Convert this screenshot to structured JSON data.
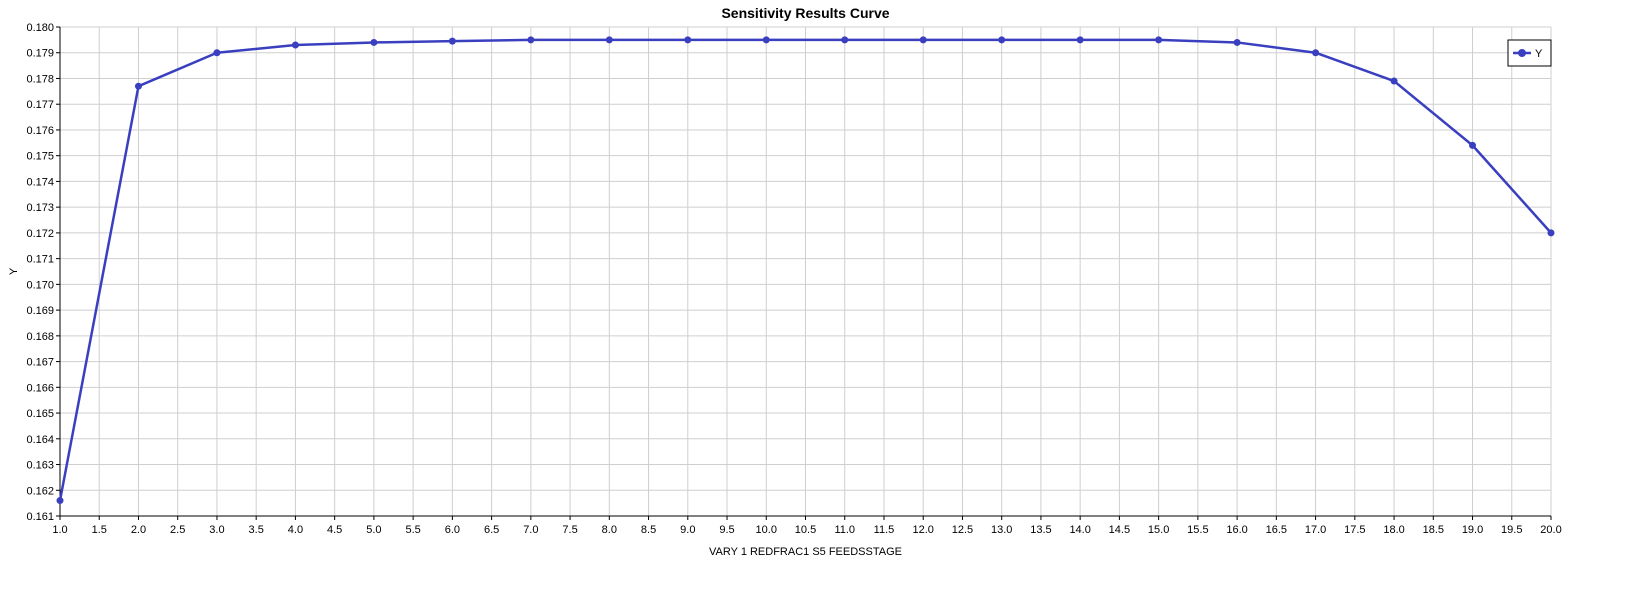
{
  "chart_data": {
    "type": "line",
    "title": "Sensitivity Results Curve",
    "xlabel": "VARY   1 REDFRAC1 S5 FEEDSSTAGE",
    "ylabel": "Y",
    "xlim": [
      1.0,
      20.0
    ],
    "ylim": [
      0.161,
      0.18
    ],
    "x_ticks": [
      "1.0",
      "1.5",
      "2.0",
      "2.5",
      "3.0",
      "3.5",
      "4.0",
      "4.5",
      "5.0",
      "5.5",
      "6.0",
      "6.5",
      "7.0",
      "7.5",
      "8.0",
      "8.5",
      "9.0",
      "9.5",
      "10.0",
      "10.5",
      "11.0",
      "11.5",
      "12.0",
      "12.5",
      "13.0",
      "13.5",
      "14.0",
      "14.5",
      "15.0",
      "15.5",
      "16.0",
      "16.5",
      "17.0",
      "17.5",
      "18.0",
      "18.5",
      "19.0",
      "19.5",
      "20.0"
    ],
    "y_ticks": [
      "0.161",
      "0.162",
      "0.163",
      "0.164",
      "0.165",
      "0.166",
      "0.167",
      "0.168",
      "0.169",
      "0.170",
      "0.171",
      "0.172",
      "0.173",
      "0.174",
      "0.175",
      "0.176",
      "0.177",
      "0.178",
      "0.179",
      "0.180"
    ],
    "grid": true,
    "legend_position": "top-right",
    "series": [
      {
        "name": "Y",
        "color": "#3a3fbf",
        "x": [
          1,
          2,
          3,
          4,
          5,
          6,
          7,
          8,
          9,
          10,
          11,
          12,
          13,
          14,
          15,
          16,
          17,
          18,
          19,
          20
        ],
        "y": [
          0.1616,
          0.1777,
          0.179,
          0.1793,
          0.1794,
          0.17945,
          0.1795,
          0.1795,
          0.1795,
          0.1795,
          0.1795,
          0.1795,
          0.1795,
          0.1795,
          0.1795,
          0.1794,
          0.179,
          0.1779,
          0.1754,
          0.172
        ]
      }
    ]
  }
}
